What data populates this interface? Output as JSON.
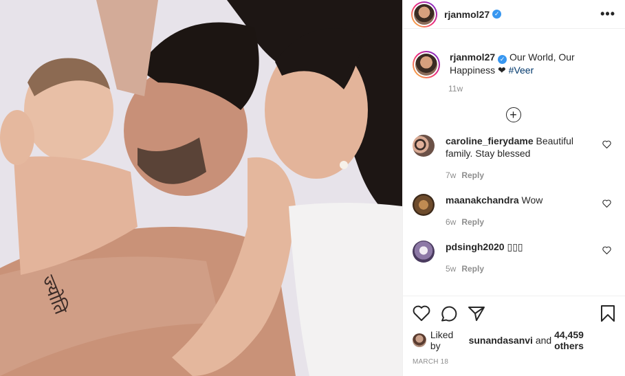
{
  "post": {
    "username": "rjanmol27",
    "caption": "Our World, Our Happiness ❤",
    "hashtag": "#Veer",
    "caption_time": "11w",
    "tattoo_text": "ज्योति"
  },
  "comments": [
    {
      "username": "caroline_fierydame",
      "text": "Beautiful family. Stay blessed",
      "time": "7w",
      "reply": "Reply"
    },
    {
      "username": "maanakchandra",
      "text": "Wow",
      "time": "6w",
      "reply": "Reply"
    },
    {
      "username": "pdsingh2020",
      "text": "▯▯▯",
      "time": "5w",
      "reply": "Reply"
    }
  ],
  "likes": {
    "prefix": "Liked by",
    "user": "sunandasanvi",
    "middle": "and",
    "count": "44,459 others"
  },
  "date": "MARCH 18",
  "colors": {
    "link": "#00376b",
    "verified": "#3897f0",
    "muted": "#8e8e8e"
  },
  "icons": [
    "more-options-icon",
    "load-more-icon",
    "like-icon",
    "comment-icon",
    "share-icon",
    "save-icon",
    "verified-icon"
  ]
}
